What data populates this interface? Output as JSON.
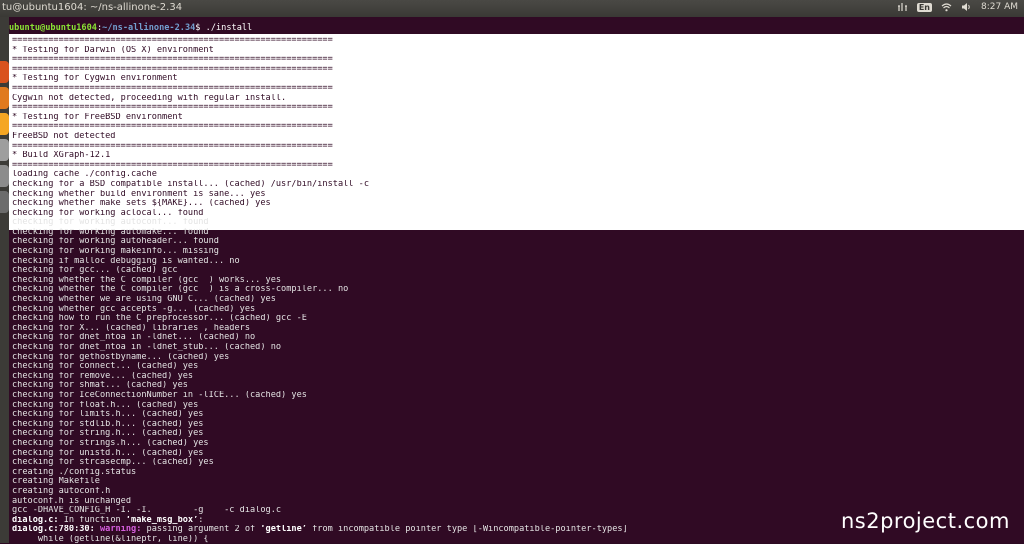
{
  "window": {
    "title": "tu@ubuntu1604: ~/ns-allinone-2.34",
    "time": "8:27 AM",
    "lang_indicator": "En",
    "tray_icons": [
      "network-icon",
      "keyboard-icon",
      "wifi-icon",
      "volume-icon"
    ]
  },
  "launcher": {
    "colors": [
      "#d9531e",
      "#e07a1f",
      "#f5a623",
      "#9e9e9e",
      "#8c8c8c",
      "#6c6c6c"
    ]
  },
  "terminal": {
    "prompt": {
      "user_host": "ubuntu@ubuntu1604",
      "path": "~/ns-allinone-2.34",
      "command": "$ ./install"
    },
    "lines": [
      "==============================================================",
      "* Testing for Darwin (OS X) environment",
      "==============================================================",
      "==============================================================",
      "* Testing for Cygwin environment",
      "==============================================================",
      "Cygwin not detected, proceeding with regular install.",
      "==============================================================",
      "* Testing for FreeBSD environment",
      "==============================================================",
      "FreeBSD not detected",
      "==============================================================",
      "* Build XGraph-12.1",
      "==============================================================",
      "loading cache ./config.cache",
      "checking for a BSD compatible install... (cached) /usr/bin/install -c",
      "checking whether build environment is sane... yes",
      "checking whether make sets ${MAKE}... (cached) yes",
      "checking for working aclocal... found",
      "checking for working autoconf... found",
      "checking for working automake... found",
      "checking for working autoheader... found",
      "checking for working makeinfo... missing",
      "checking if malloc debugging is wanted... no",
      "checking for gcc... (cached) gcc",
      "checking whether the C compiler (gcc  ) works... yes",
      "checking whether the C compiler (gcc  ) is a cross-compiler... no",
      "checking whether we are using GNU C... (cached) yes",
      "checking whether gcc accepts -g... (cached) yes",
      "checking how to run the C preprocessor... (cached) gcc -E",
      "checking for X... (cached) libraries , headers",
      "checking for dnet_ntoa in -ldnet... (cached) no",
      "checking for dnet_ntoa in -ldnet_stub... (cached) no",
      "checking for gethostbyname... (cached) yes",
      "checking for connect... (cached) yes",
      "checking for remove... (cached) yes",
      "checking for shmat... (cached) yes",
      "checking for IceConnectionNumber in -lICE... (cached) yes",
      "checking for float.h... (cached) yes",
      "checking for limits.h... (cached) yes",
      "checking for stdlib.h... (cached) yes",
      "checking for string.h... (cached) yes",
      "checking for strings.h... (cached) yes",
      "checking for unistd.h... (cached) yes",
      "checking for strcasecmp... (cached) yes",
      "creating ./config.status",
      "creating Makefile",
      "creating autoconf.h",
      "autoconf.h is unchanged",
      "gcc -DHAVE_CONFIG_H -I. -I.        -g    -c dialog.c"
    ],
    "selected_line_count": 19,
    "diag1": {
      "file": "dialog.c:",
      "text": " In function ",
      "func": "‘make_msg_box’",
      "end": ":"
    },
    "diag2": {
      "loc": "dialog.c:780:30:",
      "label": " warning:",
      "text": " passing argument 2 of ",
      "func": "‘getline’",
      "end": " from incompatible pointer type [-Wincompatible-pointer-types]"
    },
    "last_line": "     while (getline(&lineptr, line)) {"
  },
  "watermark": "ns2project.com"
}
